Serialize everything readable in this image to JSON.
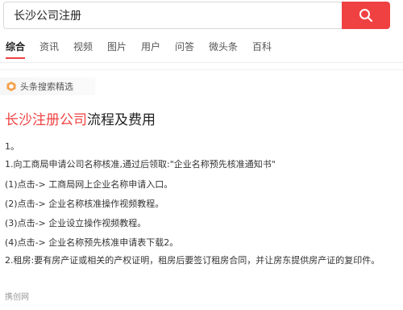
{
  "search": {
    "query": "长沙公司注册"
  },
  "tabs": [
    "综合",
    "资讯",
    "视频",
    "图片",
    "用户",
    "问答",
    "微头条",
    "百科"
  ],
  "active_tab": "综合",
  "source": {
    "label": "头条搜索精选"
  },
  "article": {
    "title_highlight": "长沙注册公司",
    "title_rest": "流程及费用",
    "lines": [
      "1。",
      "1.向工商局申请公司名称核准,通过后领取:\"企业名称预先核准通知书\"",
      "(1)点击-> 工商局网上企业名称申请入口。",
      "(2)点击-> 企业名称核准操作视频教程。",
      "(3)点击-> 企业设立操作视频教程。",
      "(4)点击-> 企业名称预先核准申请表下载2。"
    ],
    "paragraph": "2.租房:要有房产证或相关的产权证明，租房后要签订租房合同，并让房东提供房产证的复印件。",
    "site": "携创网"
  },
  "colors": {
    "accent": "#f04142",
    "source_icon": "#f5a04a"
  },
  "icons": {
    "search_button": "search-icon",
    "source": "source-badge-icon"
  }
}
